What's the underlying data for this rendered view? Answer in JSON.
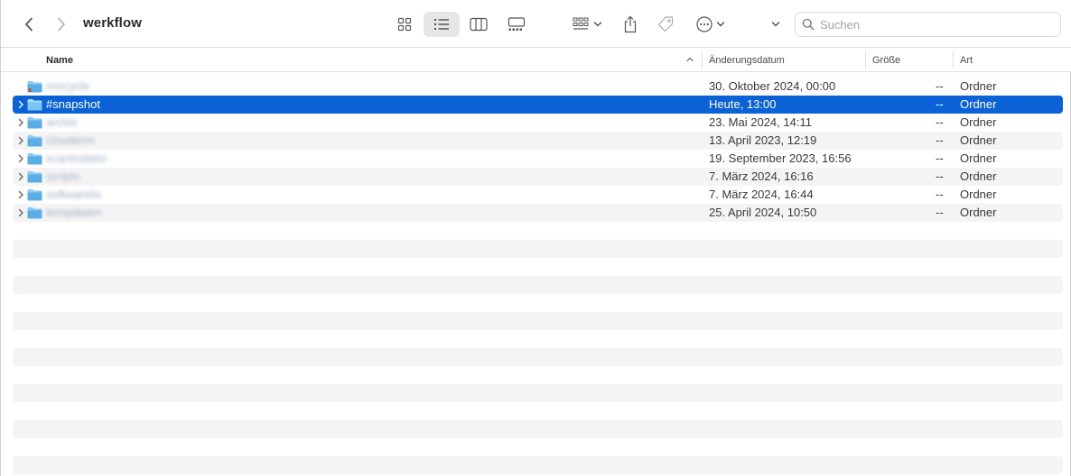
{
  "window": {
    "title": "werkflow"
  },
  "toolbar": {
    "back_icon": "chevron-left-icon",
    "forward_icon": "chevron-right-icon",
    "view_modes": [
      {
        "name": "icon-view",
        "icon": "grid-icon",
        "active": false
      },
      {
        "name": "list-view",
        "icon": "list-icon",
        "active": true
      },
      {
        "name": "column-view",
        "icon": "columns-icon",
        "active": false
      },
      {
        "name": "gallery-view",
        "icon": "gallery-icon",
        "active": false
      }
    ],
    "group_icon": "group-by-icon",
    "share_icon": "share-icon",
    "tag_icon": "tag-icon",
    "action_icon": "more-actions-icon",
    "overflow_icon": "chevron-down-icon",
    "search": {
      "placeholder": "Suchen",
      "value": ""
    }
  },
  "columns": {
    "name": "Name",
    "modified": "Änderungsdatum",
    "size": "Größe",
    "kind": "Art"
  },
  "files": [
    {
      "name": "#recycle",
      "date": "30. Oktober 2024, 00:00",
      "size": "--",
      "kind": "Ordner",
      "blurred": true,
      "expandable": false,
      "selected": false
    },
    {
      "name": "#snapshot",
      "date": "Heute, 13:00",
      "size": "--",
      "kind": "Ordner",
      "blurred": false,
      "expandable": true,
      "selected": true
    },
    {
      "name": "archiv",
      "date": "23. Mai 2024, 14:11",
      "size": "--",
      "kind": "Ordner",
      "blurred": true,
      "expandable": true,
      "selected": false
    },
    {
      "name": "clouderm",
      "date": "13. April 2023, 12:19",
      "size": "--",
      "kind": "Ordner",
      "blurred": true,
      "expandable": true,
      "selected": false
    },
    {
      "name": "scantodatei",
      "date": "19. September 2023, 16:56",
      "size": "--",
      "kind": "Ordner",
      "blurred": true,
      "expandable": true,
      "selected": false
    },
    {
      "name": "scripts",
      "date": "7. März 2024, 16:16",
      "size": "--",
      "kind": "Ordner",
      "blurred": true,
      "expandable": true,
      "selected": false
    },
    {
      "name": "softwarelis",
      "date": "7. März 2024, 16:44",
      "size": "--",
      "kind": "Ordner",
      "blurred": true,
      "expandable": true,
      "selected": false
    },
    {
      "name": "tempdaten",
      "date": "25. April 2024, 10:50",
      "size": "--",
      "kind": "Ordner",
      "blurred": true,
      "expandable": true,
      "selected": false
    }
  ],
  "colors": {
    "selection": "#0b62d7",
    "folder": "#5aaee8",
    "row_alt": "#f4f4f4"
  }
}
